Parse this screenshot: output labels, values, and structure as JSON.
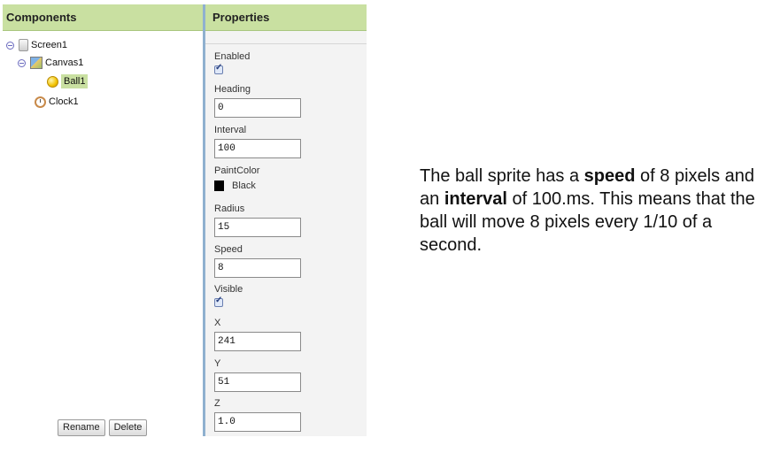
{
  "components": {
    "header": "Components",
    "tree": [
      {
        "label": "Screen1",
        "icon": "screen-icon",
        "has_toggle": true
      },
      {
        "label": "Canvas1",
        "icon": "canvas-icon",
        "has_toggle": true
      },
      {
        "label": "Ball1",
        "icon": "ball-icon",
        "selected": true
      },
      {
        "label": "Clock1",
        "icon": "clock-icon"
      }
    ],
    "rename_label": "Rename",
    "delete_label": "Delete"
  },
  "properties": {
    "header": "Properties",
    "enabled": {
      "label": "Enabled",
      "checked": true
    },
    "heading": {
      "label": "Heading",
      "value": "0"
    },
    "interval": {
      "label": "Interval",
      "value": "100"
    },
    "paint_color": {
      "label": "PaintColor",
      "value": "Black",
      "color": "#000000"
    },
    "radius": {
      "label": "Radius",
      "value": "15"
    },
    "speed": {
      "label": "Speed",
      "value": "8"
    },
    "visible": {
      "label": "Visible",
      "checked": true
    },
    "x": {
      "label": "X",
      "value": "241"
    },
    "y": {
      "label": "Y",
      "value": "51"
    },
    "z": {
      "label": "Z",
      "value": "1.0"
    }
  },
  "explanation": {
    "part1": "The ball sprite has a ",
    "bold1": "speed",
    "part2": " of 8 pixels and an ",
    "bold2": "interval",
    "part3": " of 100.ms. This means that the ball will move 8 pixels every 1/10 of a second."
  },
  "colors": {
    "header_bg": "#c9e0a1",
    "divider": "#8fb0cf",
    "properties_bg": "#f3f3f3"
  }
}
